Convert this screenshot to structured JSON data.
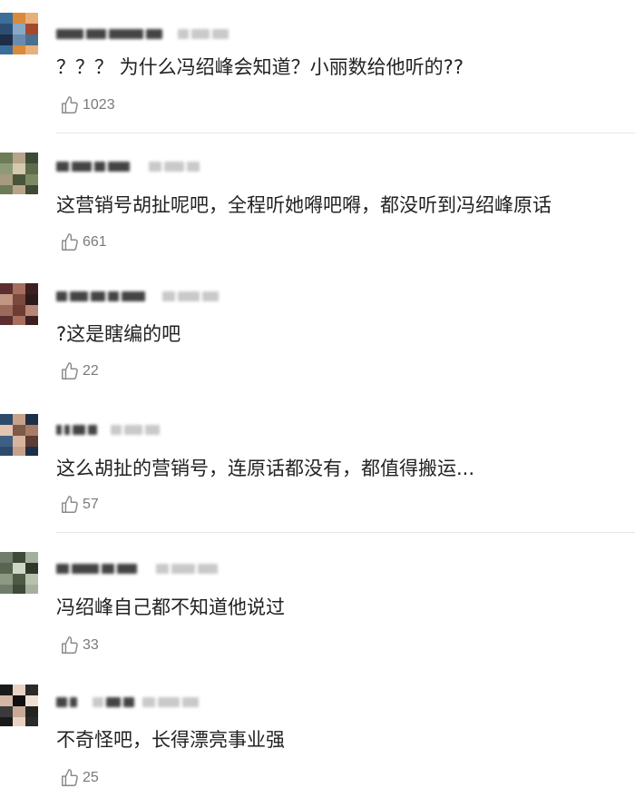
{
  "comments": [
    {
      "text": "？？？ 为什么冯绍峰会知道？小丽数给他听的??",
      "likes": "1023",
      "avatar_colors": [
        "#3b6f9a",
        "#d98a3a",
        "#e7b07b",
        "#2d4d73",
        "#8aa7c4",
        "#a44a2b",
        "#1e2e48",
        "#6a8bb0",
        "#4a6f91"
      ]
    },
    {
      "text": "这营销号胡扯呢吧，全程听她嘚吧嘚，都没听到冯绍峰原话",
      "likes": "661",
      "avatar_colors": [
        "#6e7b5a",
        "#b8a48a",
        "#3e4a33",
        "#8c9a78",
        "#d7c8b0",
        "#5d6b4a",
        "#a79a80",
        "#48553a",
        "#7c8a64"
      ]
    },
    {
      "text": "?这是瞎编的吧",
      "likes": "22",
      "avatar_colors": [
        "#5b2f2f",
        "#a66e5e",
        "#3d1f1f",
        "#c29584",
        "#7a4a3e",
        "#2e1a1a",
        "#9c6a5b",
        "#6d3d35",
        "#b88576"
      ]
    },
    {
      "text": "这么胡扯的营销号，连原话都没有，都值得搬运...",
      "likes": "57",
      "avatar_colors": [
        "#2e4a6b",
        "#c7a18a",
        "#1d2f46",
        "#e2c4b0",
        "#7d5a4a",
        "#a97a66",
        "#3e5f82",
        "#d9b49c",
        "#5c3d33"
      ]
    },
    {
      "text": "冯绍峰自己都不知道他说过",
      "likes": "33",
      "avatar_colors": [
        "#6f7d6a",
        "#3f4a3b",
        "#a5b09c",
        "#58654f",
        "#cfd6c6",
        "#2f382b",
        "#8c9a84",
        "#4d5a46",
        "#b7c1ad"
      ]
    },
    {
      "text": "不奇怪吧，长得漂亮事业强",
      "likes": "25",
      "avatar_colors": [
        "#1a1a1a",
        "#e8d2c4",
        "#2a2a2a",
        "#d4b6a4",
        "#0f0f0f",
        "#f0e0d4",
        "#3a3a3a",
        "#c9a896",
        "#222222"
      ]
    }
  ]
}
